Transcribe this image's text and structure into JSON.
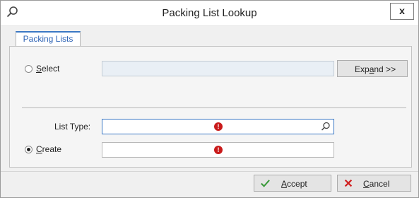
{
  "window": {
    "title": "Packing List Lookup",
    "close_label": "x",
    "icon": "search-icon"
  },
  "tabs": [
    {
      "label": "Packing Lists",
      "active": true
    }
  ],
  "select_option": {
    "label": "Select",
    "checked": false,
    "value": "",
    "expand_label": "Expand >>"
  },
  "list_type": {
    "label": "List Type:",
    "value": "",
    "required_icon": "required-error-icon",
    "lookup_icon": "search-icon"
  },
  "create_option": {
    "label": "Create",
    "checked": true,
    "value": "",
    "required_icon": "required-error-icon"
  },
  "footer": {
    "accept_label": "Accept",
    "accept_icon": "checkmark-icon",
    "cancel_label": "Cancel",
    "cancel_icon": "x-mark-icon"
  },
  "colors": {
    "accent": "#3b78c4",
    "required": "#c91a1a",
    "accept_green": "#3a9a3a",
    "cancel_red": "#d02020"
  }
}
